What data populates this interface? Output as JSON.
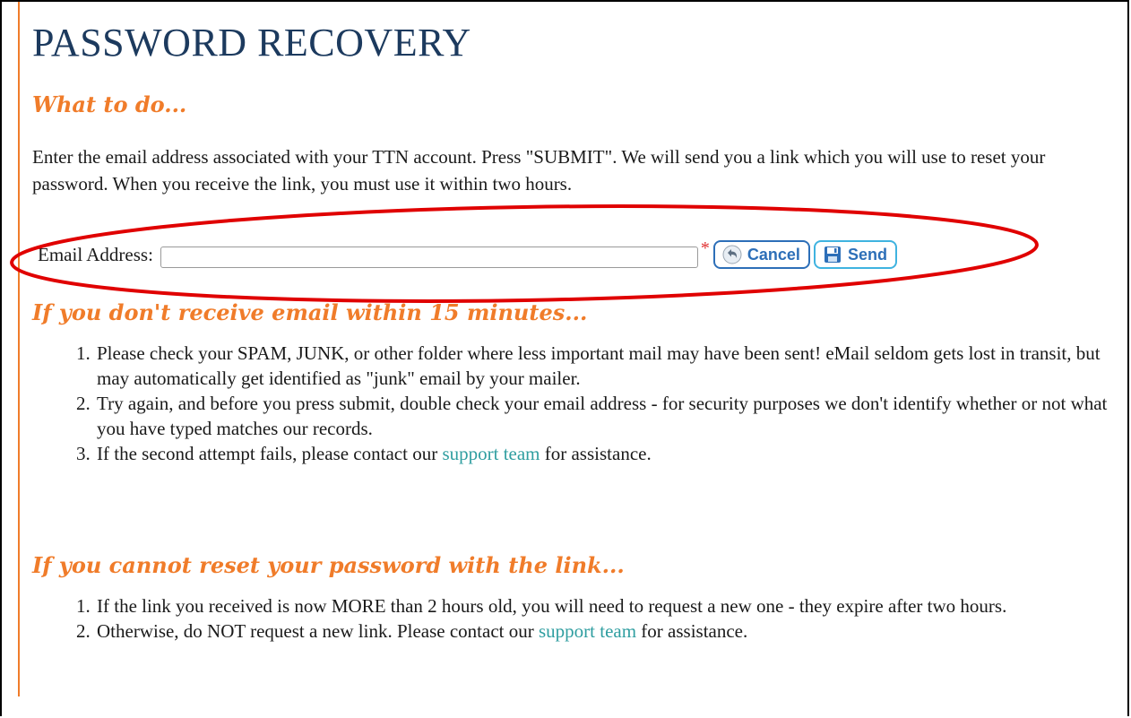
{
  "page": {
    "title": "PASSWORD RECOVERY"
  },
  "what_to_do": {
    "heading": "What to do...",
    "text": "Enter the email address associated with your TTN account.  Press \"SUBMIT\".  We will send you a link which you will use to reset your password.  When you receive the link, you must use it within two hours."
  },
  "form": {
    "email_label": "Email Address:",
    "email_value": "",
    "required_marker": "*",
    "cancel_label": "Cancel",
    "send_label": "Send"
  },
  "no_email": {
    "heading": "If you don't receive email within 15 minutes...",
    "items": [
      {
        "text": "Please check your SPAM, JUNK, or other folder where less important mail may have been sent!  eMail seldom gets lost in transit, but may automatically get identified as \"junk\" email by your mailer."
      },
      {
        "text": "Try again, and before you press submit, double check your email address - for security purposes we don't identify whether or not what you have typed matches our records."
      },
      {
        "before": "If the second attempt fails, please contact our ",
        "link": "support team",
        "after": " for assistance."
      }
    ]
  },
  "cannot_reset": {
    "heading": "If you cannot reset your password with the link...",
    "items": [
      {
        "text": "If the link you received is now MORE than 2 hours old, you will need to request a new one - they expire after two hours."
      },
      {
        "before": "Otherwise, do NOT request a new link.  Please contact our ",
        "link": "support team",
        "after": " for assistance."
      }
    ]
  },
  "colors": {
    "heading_orange": "#f07c2a",
    "title_navy": "#1c3a5e",
    "link_teal": "#2f9ea0",
    "annotation_red": "#e00000",
    "button_blue": "#2d6fb8"
  }
}
